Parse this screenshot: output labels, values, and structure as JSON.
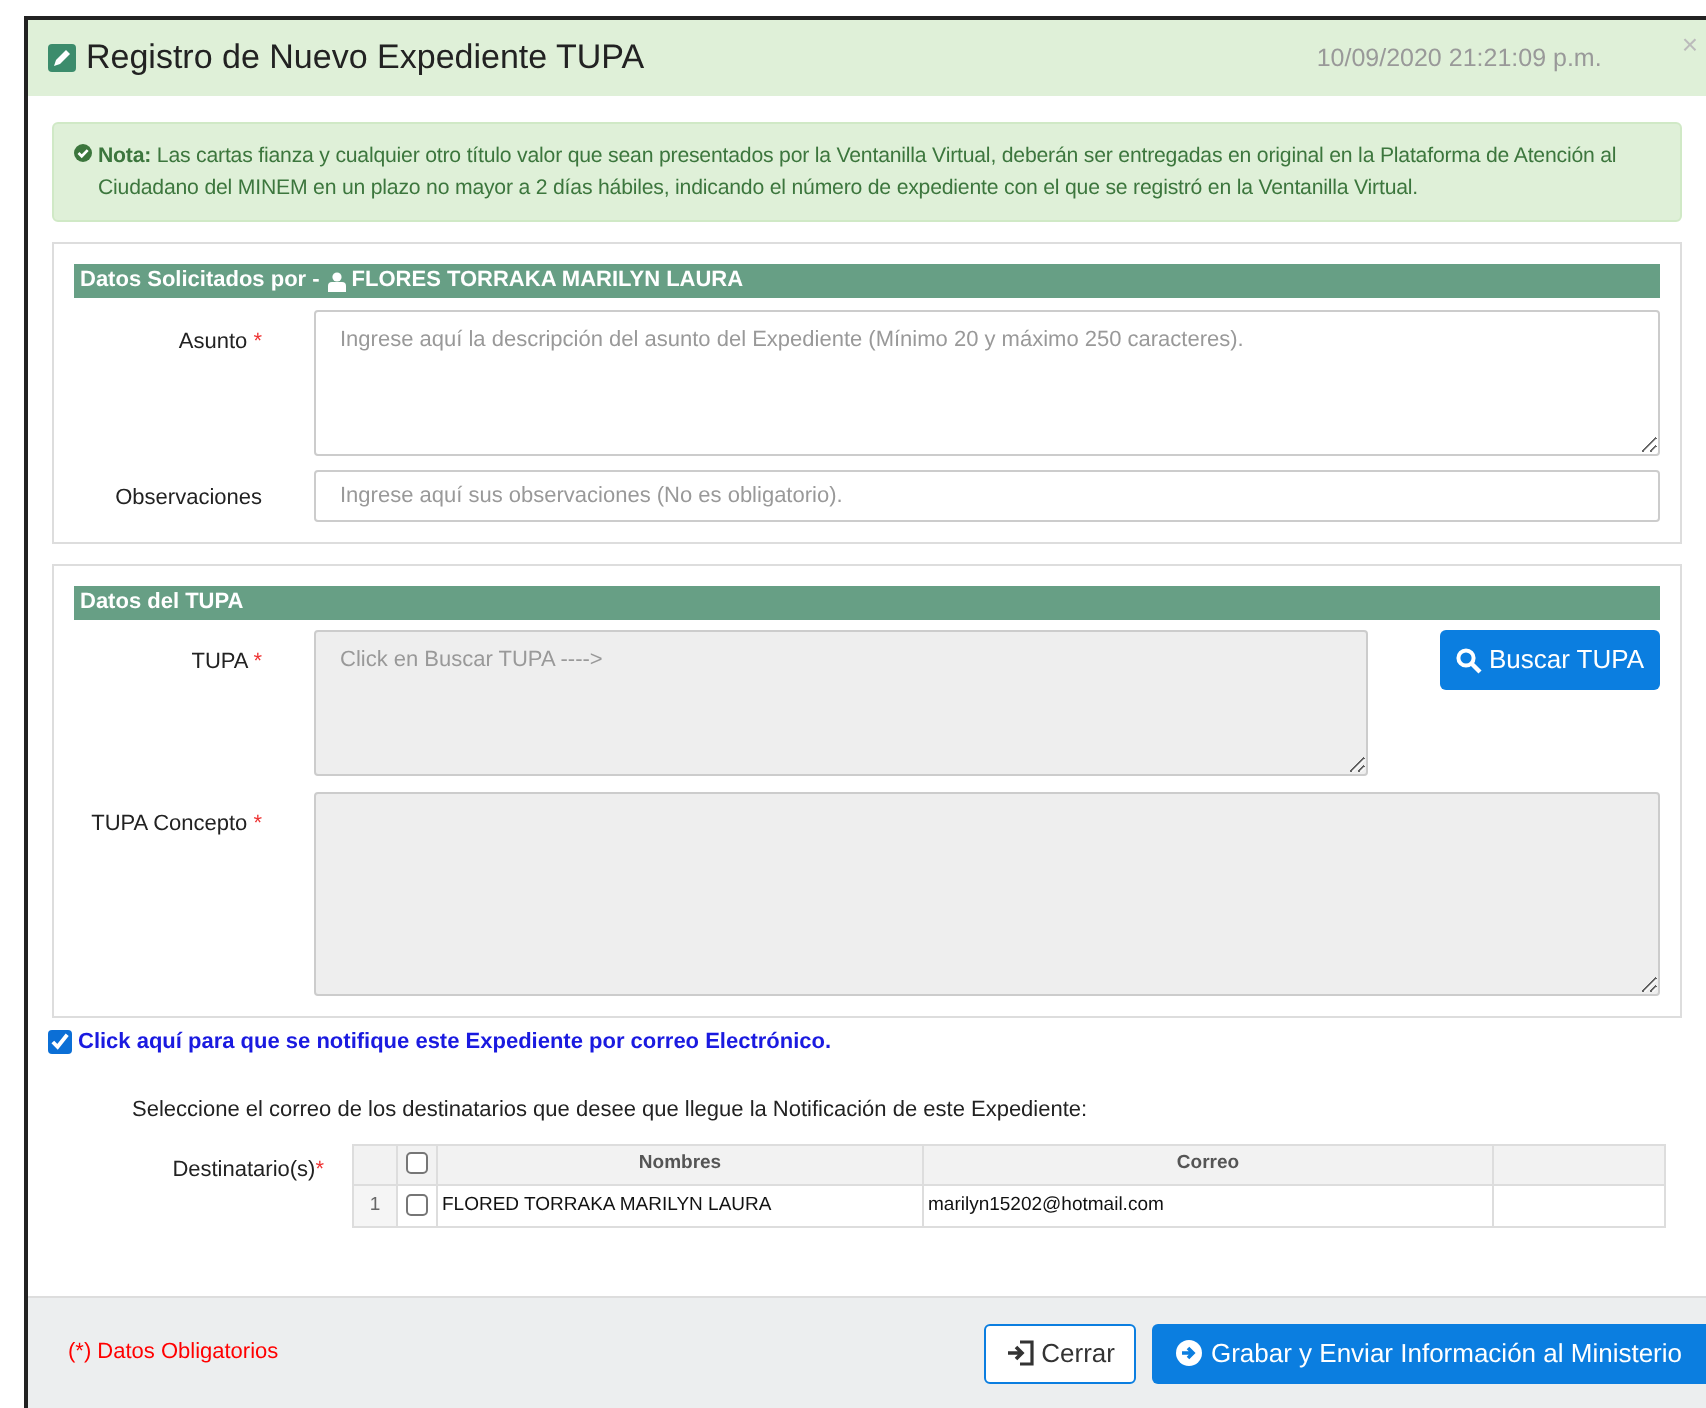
{
  "modal": {
    "title": "Registro de Nuevo Expediente TUPA",
    "datetime": "10/09/2020 21:21:09 p.m.",
    "close": "×"
  },
  "note": {
    "text": "**Nota:** Las cartas fianza y cualquier otro título valor que sean presentados por la Ventanilla Virtual, deberán ser entregadas en original en la Plataforma de Atención al Ciudadano del MINEM en un plazo no mayor a 2 días hábiles, indicando el número de expediente con el que se registró en la Ventanilla Virtual."
  },
  "section_solicitante": {
    "title": "Datos Solicitados por -",
    "person": "FLORES TORRAKA MARILYN LAURA",
    "fields": [
      {
        "label": "Asunto",
        "required": "*",
        "placeholder": "Ingrese aquí la descripción del asunto del Expediente (Mínimo 20 y máximo 250 caracteres).",
        "kind": "textarea",
        "disabled": false
      },
      {
        "label": "Observaciones",
        "placeholder": "Ingrese aquí sus observaciones (No es obligatorio).",
        "kind": "input",
        "disabled": false
      }
    ]
  },
  "section_tupa": {
    "title": "Datos del TUPA",
    "fields": [
      {
        "label": "TUPA",
        "required": "*",
        "placeholder": "Click en Buscar TUPA ---->",
        "kind": "textarea",
        "disabled": true
      },
      {
        "label": "TUPA Concepto",
        "required": "*",
        "kind": "textarea",
        "disabled": true
      }
    ],
    "search_button": "Buscar TUPA"
  },
  "notify": {
    "label": "Click aquí para que se notifique este Expediente por correo Electrónico.",
    "checked": true
  },
  "recipients": {
    "instruction": "Seleccione el correo de los destinatarios que desee que llegue la Notificación de este Expediente:",
    "label": "Destinatario(s)",
    "required": "*",
    "header_checked": false,
    "columns": [
      "Nombres",
      "Correo"
    ],
    "rows": [
      {
        "number": "1",
        "checked": false,
        "nombres": "FLORED TORRAKA MARILYN LAURA",
        "correo": "marilyn15202@hotmail.com"
      }
    ]
  },
  "footer": {
    "required_note": "(*) Datos Obligatorios",
    "buttons": [
      "Cerrar",
      "Grabar y Enviar Información al Ministerio"
    ]
  }
}
